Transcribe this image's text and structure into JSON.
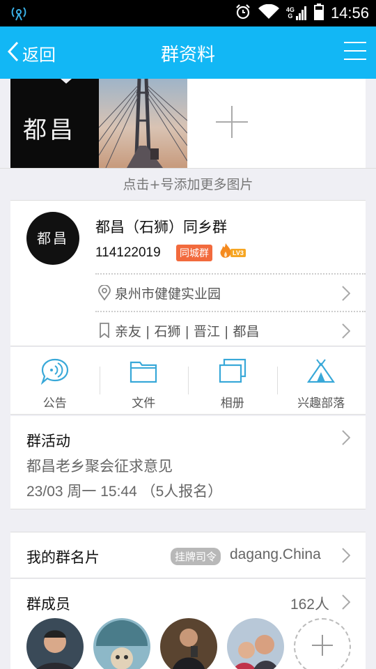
{
  "status_bar": {
    "time": "14:56",
    "network": "4G",
    "network_sub": "G"
  },
  "app_bar": {
    "back_label": "返回",
    "title": "群资料"
  },
  "photos": {
    "logo_text": "都昌",
    "add_hint": "点击+号添加更多图片"
  },
  "group": {
    "avatar_text": "都昌",
    "name": "都昌（石狮）同乡群",
    "id": "114122019",
    "badge": "同城群",
    "level": "LV3",
    "address": "泉州市健健实业园",
    "tags": "亲友 | 石狮 | 晋江 | 都昌"
  },
  "tools": [
    {
      "label": "公告"
    },
    {
      "label": "文件"
    },
    {
      "label": "相册"
    },
    {
      "label": "兴趣部落"
    }
  ],
  "activity": {
    "heading": "群活动",
    "title": "都昌老乡聚会征求意见",
    "detail": "23/03 周一 15:44 （5人报名）"
  },
  "my_card": {
    "label": "我的群名片",
    "title_badge": "挂牌司令",
    "nickname": "dagang.China"
  },
  "members": {
    "label": "群成员",
    "count": "162人"
  },
  "colors": {
    "accent": "#12b7f5",
    "icon_blue": "#38a8d8",
    "badge_orange": "#f26a3d"
  }
}
